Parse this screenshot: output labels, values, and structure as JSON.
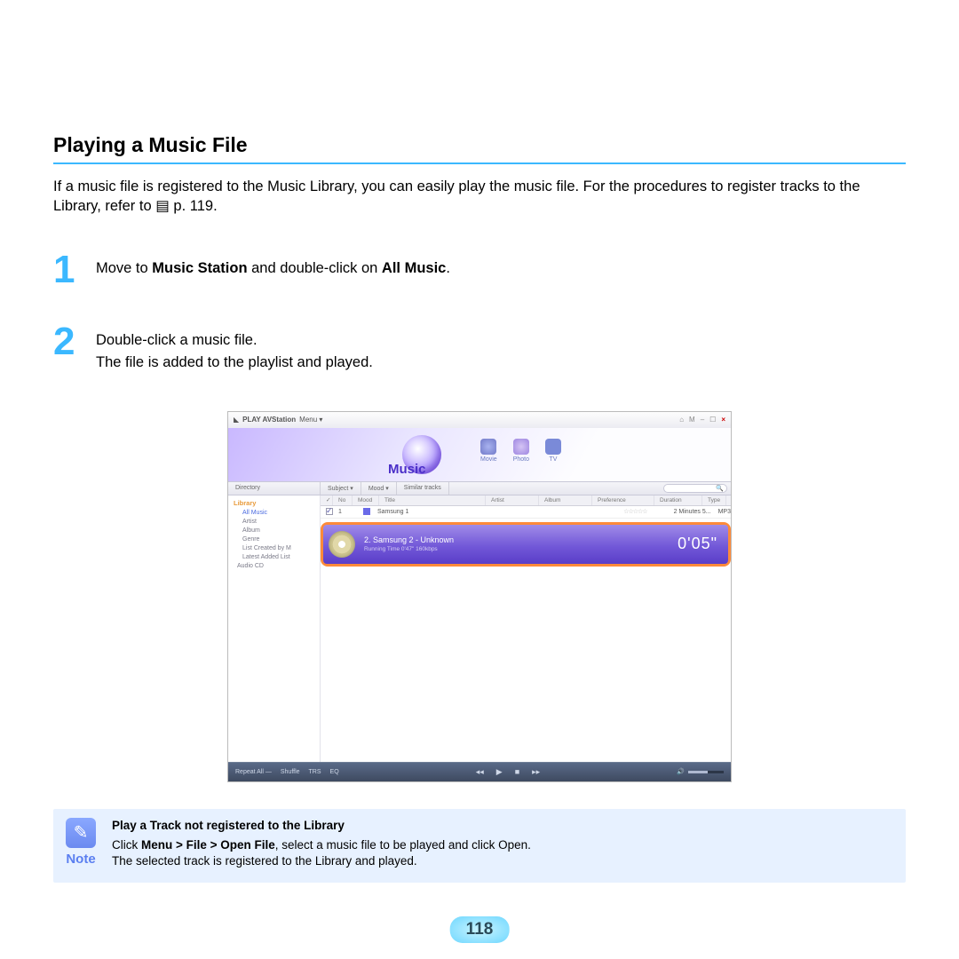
{
  "heading": "Playing a Music File",
  "intro_1": "If a music file is registered to the Music Library, you can easily play the music file. For the procedures to register tracks to the Library, refer to ",
  "intro_ref": "p. 119",
  "steps": {
    "one": {
      "num": "1",
      "a": "Move to ",
      "b": "Music Station",
      "c": " and double-click on ",
      "d": "All Music",
      "e": "."
    },
    "two": {
      "num": "2",
      "l1": "Double-click a music file.",
      "l2": "The file is added to the playlist and played."
    }
  },
  "app": {
    "title_prefix": "PLAY AVStation",
    "menu": "Menu ▾",
    "winbtns": [
      "⌂",
      "M",
      "–",
      "☐",
      "×"
    ],
    "tabs": {
      "music": "Music",
      "movie": "Movie",
      "photo": "Photo",
      "tv": "TV"
    },
    "filter": {
      "directory": "Directory",
      "subject": "Subject ▾",
      "mood": "Mood ▾",
      "similar": "Similar tracks"
    },
    "search_placeholder": "",
    "cols": [
      "✓",
      "No",
      "Mood",
      "Title",
      "Artist",
      "Album",
      "Preference",
      "Duration",
      "Type"
    ],
    "sidebar": {
      "root": "Library",
      "items": [
        "All Music",
        "Artist",
        "Album",
        "Genre",
        "List Created by M",
        "Latest Added List",
        "Audio CD"
      ]
    },
    "row1": {
      "no": "1",
      "title": "Samsung 1",
      "stars": "☆☆☆☆☆",
      "duration": "2 Minutes 5...",
      "type": "MP3"
    },
    "nowplaying": {
      "track": "2.  Samsung 2 - Unknown",
      "sub": "Running Time 0'47\"     160kbps",
      "time": "0'05\""
    },
    "playbar": {
      "repeat": "Repeat All —",
      "shuffle": "Shuffle",
      "trs": "TRS",
      "eq": "EQ"
    }
  },
  "note": {
    "label": "Note",
    "title": "Play a Track not registered to the Library",
    "l1a": "Click ",
    "l1b": "Menu > File > Open File",
    "l1c": ", select a music file to be played and click Open.",
    "l2": "The selected track is registered to the Library and played."
  },
  "page_number": "118"
}
